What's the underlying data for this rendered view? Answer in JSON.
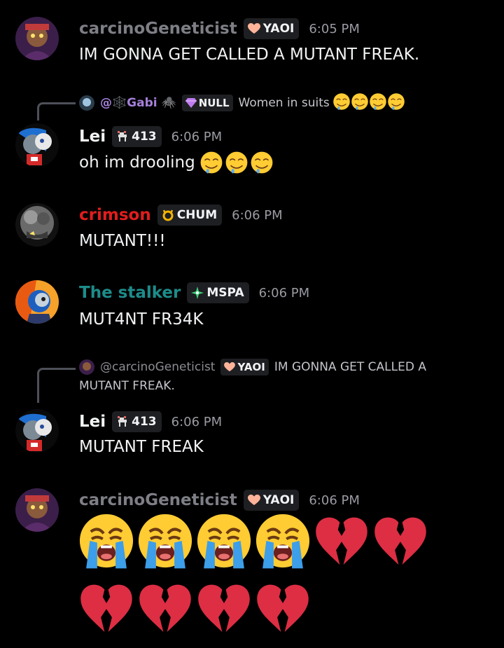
{
  "messages": [
    {
      "author": "carcinoGeneticist",
      "tag": "YAOI",
      "tag_icon": "peach-heart-icon",
      "time": "6:05 PM",
      "text": "IM GONNA GET CALLED A MUTANT FREAK."
    },
    {
      "reply": {
        "author": "@🕸️Gabi 🕷️",
        "tag": "NULL",
        "tag_icon": "gem-icon",
        "text": "Women in suits"
      },
      "author": "Lei",
      "tag": "413",
      "tag_icon": "goat-icon",
      "time": "6:06 PM",
      "text": "oh im drooling"
    },
    {
      "author": "crimson",
      "tag": "CHUM",
      "tag_icon": "horns-icon",
      "time": "6:06 PM",
      "text": "MUTANT!!!"
    },
    {
      "author": "The stalker",
      "tag": "MSPA",
      "tag_icon": "sparkle-icon",
      "time": "6:06 PM",
      "text": "MUT4NT FR34K"
    },
    {
      "reply": {
        "author": "@carcinoGeneticist",
        "tag": "YAOI",
        "tag_icon": "peach-heart-icon",
        "text": "IM GONNA GET CALLED A",
        "text_cont": "MUTANT FREAK."
      },
      "author": "Lei",
      "tag": "413",
      "tag_icon": "goat-icon",
      "time": "6:06 PM",
      "text": "MUTANT FREAK"
    },
    {
      "author": "carcinoGeneticist",
      "tag": "YAOI",
      "tag_icon": "peach-heart-icon",
      "time": "6:06 PM",
      "emoji_row1": [
        "loudly-crying-face",
        "loudly-crying-face",
        "loudly-crying-face",
        "loudly-crying-face",
        "broken-heart",
        "broken-heart"
      ],
      "emoji_row2": [
        "broken-heart",
        "broken-heart",
        "broken-heart",
        "broken-heart"
      ]
    }
  ],
  "colors": {
    "background": "#000000",
    "username_grey": "#7e7f86",
    "username_red": "#e11d1d",
    "username_teal": "#1d8c8a",
    "timestamp": "#9a9ba2"
  }
}
